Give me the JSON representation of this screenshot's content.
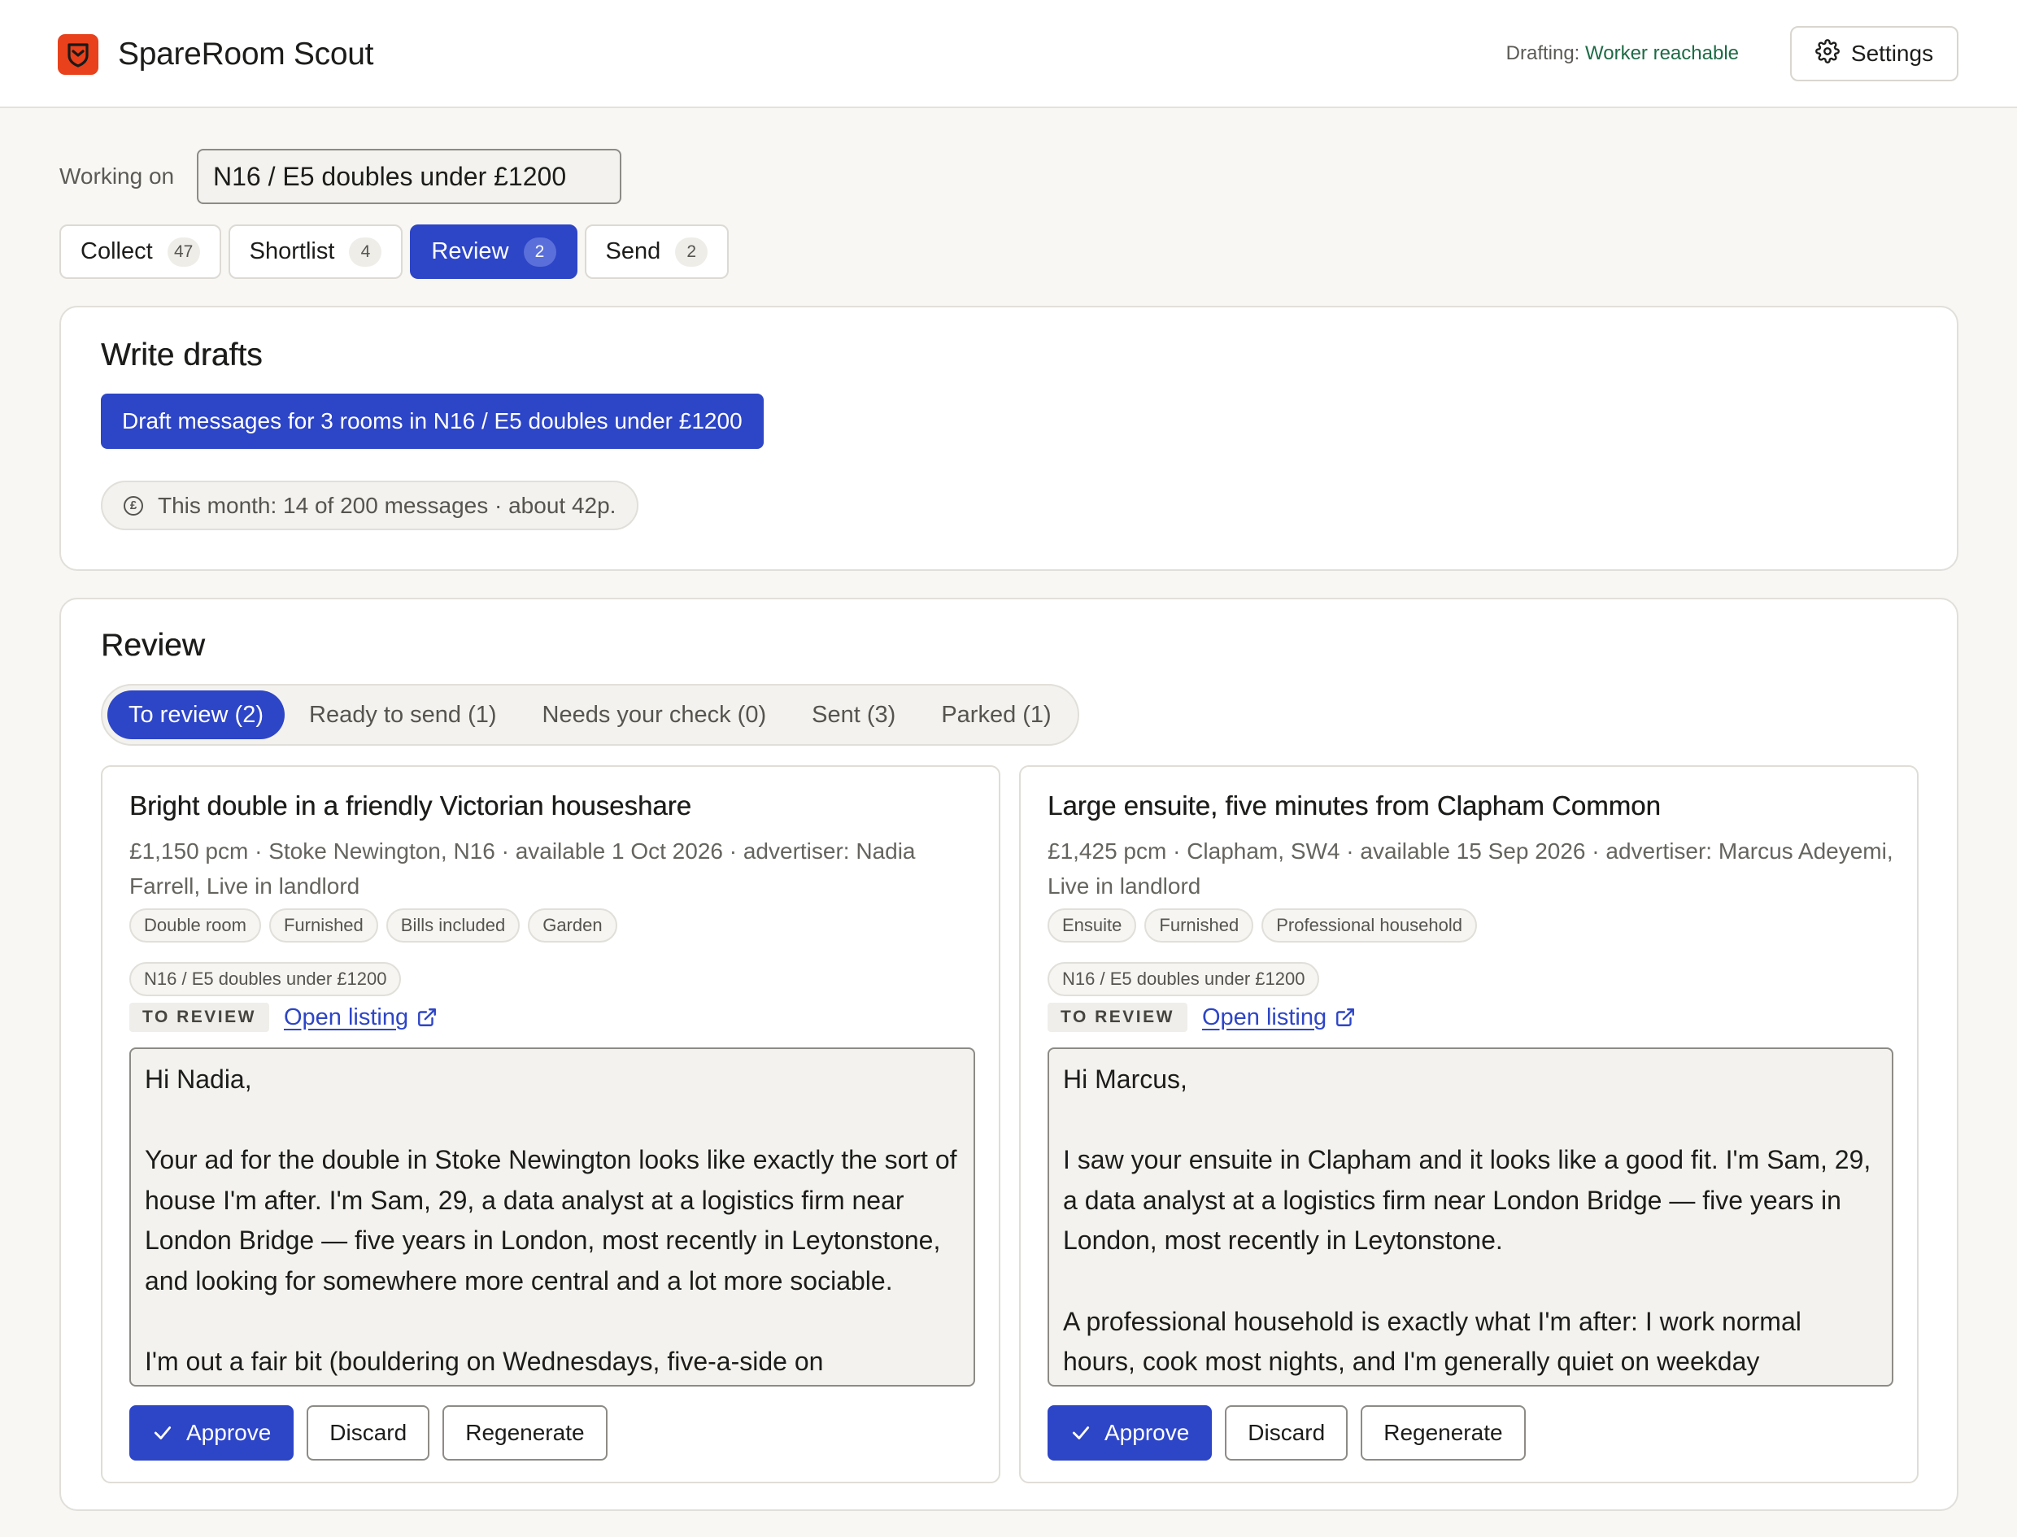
{
  "app": {
    "title": "SpareRoom Scout",
    "drafting_label": "Drafting:",
    "drafting_status": "Worker reachable",
    "settings_label": "Settings"
  },
  "working_on": {
    "label": "Working on",
    "value": "N16 / E5 doubles under £1200"
  },
  "stage_tabs": [
    {
      "label": "Collect",
      "count": "47",
      "active": false
    },
    {
      "label": "Shortlist",
      "count": "4",
      "active": false
    },
    {
      "label": "Review",
      "count": "2",
      "active": true
    },
    {
      "label": "Send",
      "count": "2",
      "active": false
    }
  ],
  "write_drafts": {
    "heading": "Write drafts",
    "button_label": "Draft messages for 3 rooms in N16 / E5 doubles under £1200",
    "usage_text": "This month: 14 of 200 messages · about 42p."
  },
  "review": {
    "heading": "Review",
    "tabs": [
      {
        "label": "To review (2)",
        "active": true
      },
      {
        "label": "Ready to send (1)",
        "active": false
      },
      {
        "label": "Needs your check (0)",
        "active": false
      },
      {
        "label": "Sent (3)",
        "active": false
      },
      {
        "label": "Parked (1)",
        "active": false
      }
    ],
    "listings": [
      {
        "title": "Bright double in a friendly Victorian houseshare",
        "meta": "£1,150 pcm · Stoke Newington, N16 · available 1 Oct 2026 · advertiser: Nadia Farrell, Live in landlord",
        "tags": [
          "Double room",
          "Furnished",
          "Bills included",
          "Garden"
        ],
        "search": "N16 / E5 doubles under £1200",
        "status": "TO REVIEW",
        "open_link": "Open listing",
        "message": "Hi Nadia,\n\nYour ad for the double in Stoke Newington looks like exactly the sort of house I'm after. I'm Sam, 29, a data analyst at a logistics firm near London Bridge — five years in London, most recently in Leytonstone, and looking for somewhere more central and a lot more sociable.\n\nI'm out a fair bit (bouldering on Wednesdays, five-a-side on",
        "actions": {
          "approve": "Approve",
          "discard": "Discard",
          "regenerate": "Regenerate"
        }
      },
      {
        "title": "Large ensuite, five minutes from Clapham Common",
        "meta": "£1,425 pcm · Clapham, SW4 · available 15 Sep 2026 · advertiser: Marcus Adeyemi, Live in landlord",
        "tags": [
          "Ensuite",
          "Furnished",
          "Professional household"
        ],
        "search": "N16 / E5 doubles under £1200",
        "status": "TO REVIEW",
        "open_link": "Open listing",
        "message": "Hi Marcus,\n\nI saw your ensuite in Clapham and it looks like a good fit. I'm Sam, 29, a data analyst at a logistics firm near London Bridge — five years in London, most recently in Leytonstone.\n\nA professional household is exactly what I'm after: I work normal hours, cook most nights, and I'm generally quiet on weekday",
        "actions": {
          "approve": "Approve",
          "discard": "Discard",
          "regenerate": "Regenerate"
        }
      }
    ]
  },
  "icons": {
    "logo": "shield-logo-icon",
    "settings": "gear-icon",
    "usage": "coin-icon",
    "open_link": "external-link-icon",
    "approve": "check-icon"
  },
  "colors": {
    "accent": "#2d45c7",
    "brand": "#e8411b",
    "status_ok": "#1d6b45",
    "background": "#f8f7f4"
  }
}
